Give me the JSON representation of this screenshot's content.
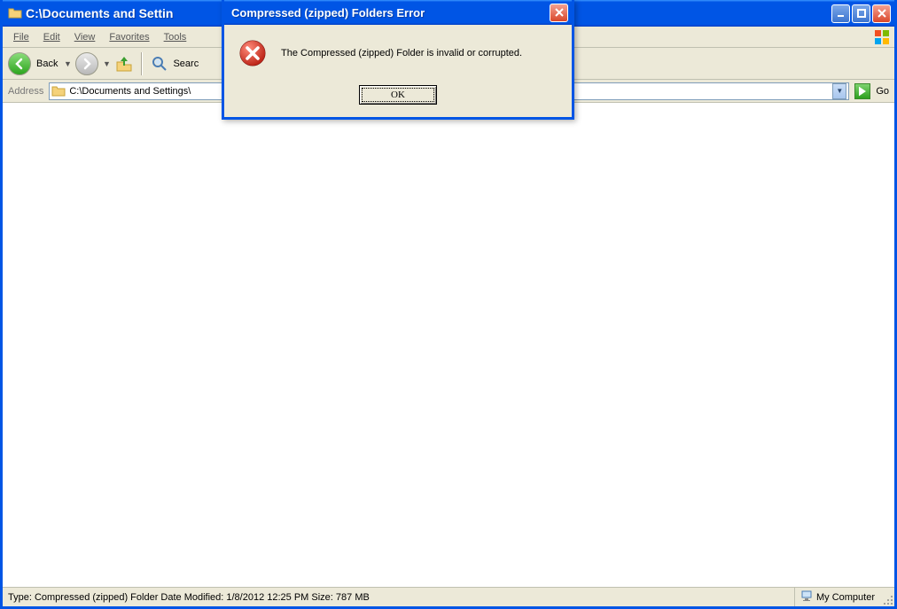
{
  "window": {
    "title": "C:\\Documents and Settin"
  },
  "menu": {
    "file": "File",
    "edit": "Edit",
    "view": "View",
    "favorites": "Favorites",
    "tools": "Tools"
  },
  "toolbar": {
    "back": "Back",
    "search": "Searc"
  },
  "address": {
    "label": "Address",
    "path": "C:\\Documents and Settings\\",
    "go": "Go"
  },
  "status": {
    "left": "Type: Compressed (zipped) Folder Date Modified: 1/8/2012 12:25 PM Size: 787 MB",
    "right": "My Computer"
  },
  "dialog": {
    "title": "Compressed (zipped) Folders Error",
    "message": "The Compressed (zipped) Folder is invalid or corrupted.",
    "ok": "OK"
  }
}
